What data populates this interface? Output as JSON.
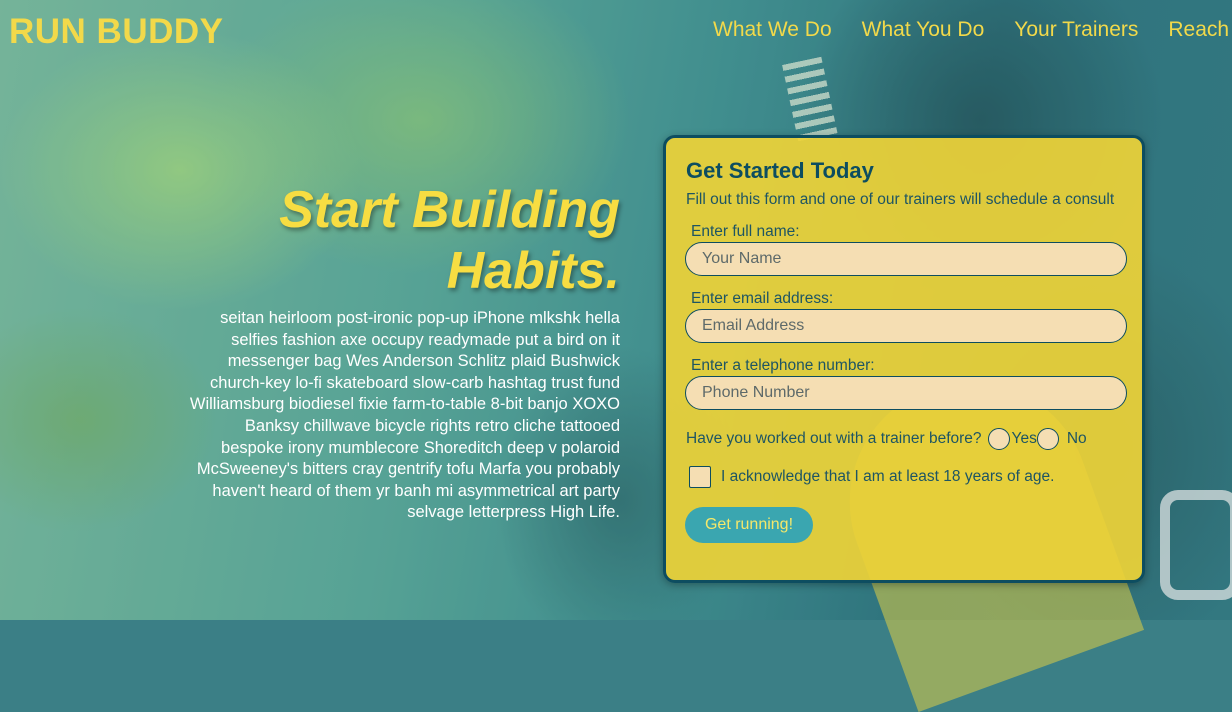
{
  "brand": {
    "logo": "RUN BUDDY"
  },
  "nav": {
    "items": [
      {
        "label": "What We Do"
      },
      {
        "label": "What You Do"
      },
      {
        "label": "Your Trainers"
      },
      {
        "label": "Reach Out"
      }
    ]
  },
  "hero": {
    "title": "Start Building Habits.",
    "body": "seitan heirloom post-ironic pop-up iPhone mlkshk hella selfies fashion axe occupy readymade put a bird on it messenger bag Wes Anderson Schlitz plaid Bushwick church-key lo-fi skateboard slow-carb hashtag trust fund Williamsburg biodiesel fixie farm-to-table 8-bit banjo XOXO Banksy chillwave bicycle rights retro cliche tattooed bespoke irony mumblecore Shoreditch deep v polaroid McSweeney's bitters cray gentrify tofu Marfa you probably haven't heard of them yr banh mi asymmetrical art party selvage letterpress High Life."
  },
  "form": {
    "title": "Get Started Today",
    "subtitle": "Fill out this form and one of our trainers will schedule a consult",
    "name": {
      "label": "Enter full name:",
      "placeholder": "Your Name",
      "value": ""
    },
    "email": {
      "label": "Enter email address:",
      "placeholder": "Email Address",
      "value": ""
    },
    "phone": {
      "label": "Enter a telephone number:",
      "placeholder": "Phone Number",
      "value": ""
    },
    "trainer_question": {
      "label": "Have you worked out with a trainer before?",
      "options": [
        "Yes",
        "No"
      ],
      "selected": null
    },
    "age_ack": {
      "label": "I acknowledge that I am at least 18 years of age.",
      "checked": false
    },
    "submit_label": "Get running!"
  },
  "colors": {
    "accent_yellow": "#f2d94a",
    "form_bg": "#eed237",
    "dark_teal": "#0d4d60",
    "button_teal": "#3aa6b0",
    "input_bg": "#f5deb3"
  }
}
